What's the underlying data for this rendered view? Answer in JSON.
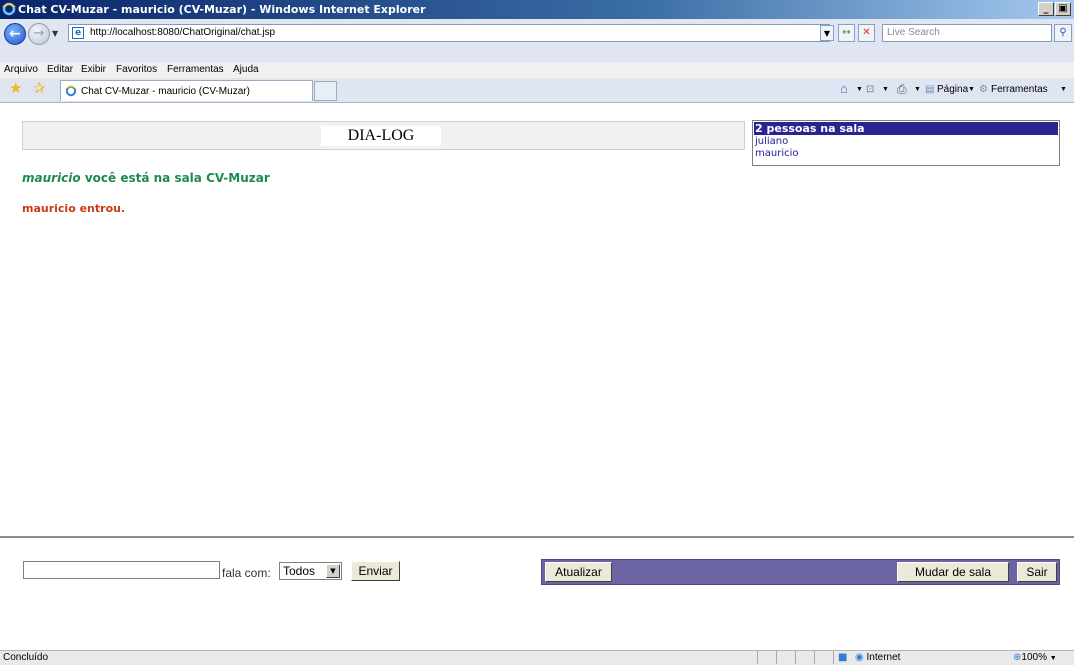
{
  "window": {
    "title": "Chat CV-Muzar - mauricio (CV-Muzar) - Windows Internet Explorer",
    "minimize": "_",
    "restore": "ø"
  },
  "address_bar": {
    "url": "http://localhost:8080/ChatOriginal/chat.jsp",
    "search_placeholder": "Live Search"
  },
  "menu": {
    "items": [
      "Arquivo",
      "Editar",
      "Exibir",
      "Favoritos",
      "Ferramentas",
      "Ajuda"
    ]
  },
  "tab": {
    "label": "Chat CV-Muzar - mauricio (CV-Muzar)"
  },
  "command_bar": {
    "page": "Página",
    "tools": "Ferramentas"
  },
  "chat": {
    "header": "DIA-LOG",
    "users_header": "2 pessoas na sala",
    "users": [
      "juliano",
      "mauricio"
    ],
    "room_user": "mauricio",
    "room_text": " você está na sala CV-Muzar",
    "entered_message": "mauricio entrou."
  },
  "controls": {
    "message_value": "",
    "talk_with_label": "fala com:",
    "talk_with_selected": "Todos",
    "send": "Enviar",
    "refresh": "Atualizar",
    "change_room": "Mudar de sala",
    "exit": "Sair"
  },
  "status_bar": {
    "status": "Concluído",
    "zone": "Internet",
    "zoom": "100%"
  }
}
